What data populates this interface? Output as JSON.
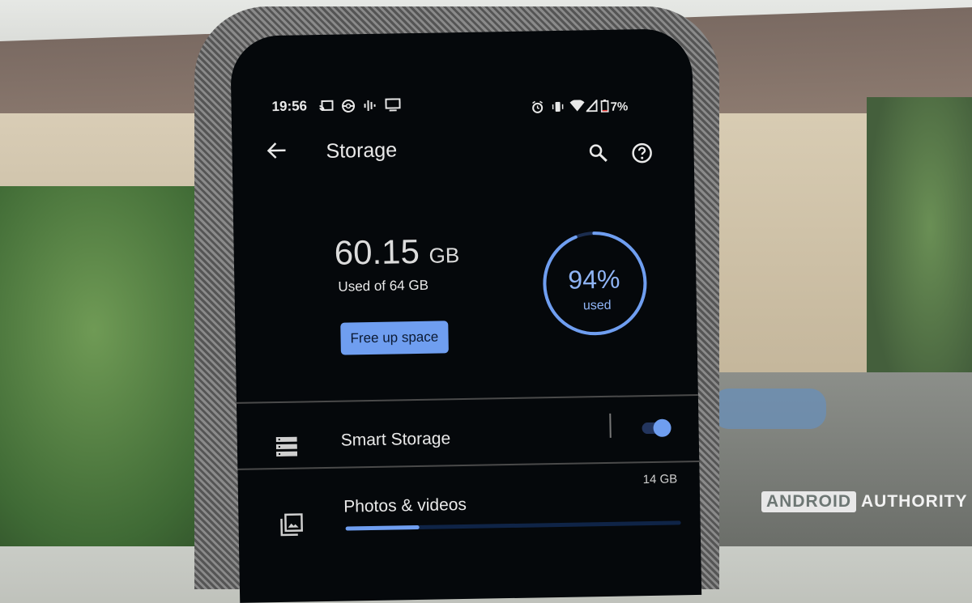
{
  "status_bar": {
    "time": "19:56",
    "left_icons": [
      "cast-icon",
      "pokeball-icon",
      "equalizer-icon",
      "tv-icon"
    ],
    "right_icons": [
      "alarm-icon",
      "vibrate-icon",
      "wifi-icon",
      "signal-icon",
      "battery-icon"
    ],
    "battery_percent": "7%"
  },
  "app_bar": {
    "back_icon": "arrow-left-icon",
    "title": "Storage",
    "search_icon": "search-icon",
    "help_icon": "help-circle-icon"
  },
  "summary": {
    "used_value": "60.15",
    "used_unit": "GB",
    "used_of_total": "Used of 64 GB",
    "free_up_button": "Free up space",
    "ring_percent_label": "94%",
    "ring_used_label": "used",
    "used_fraction": 0.94
  },
  "settings_rows": [
    {
      "icon": "list-icon",
      "label": "Smart Storage",
      "toggle_on": true
    }
  ],
  "categories": [
    {
      "icon": "photo-library-icon",
      "label": "Photos & videos",
      "size": "14 GB",
      "fraction": 0.22
    }
  ],
  "colors": {
    "accent": "#6f9ef0",
    "ring_track": "#1b2d4f",
    "background": "#05080b"
  },
  "watermark": {
    "part1": "ANDROID",
    "part2": "AUTHORITY"
  }
}
